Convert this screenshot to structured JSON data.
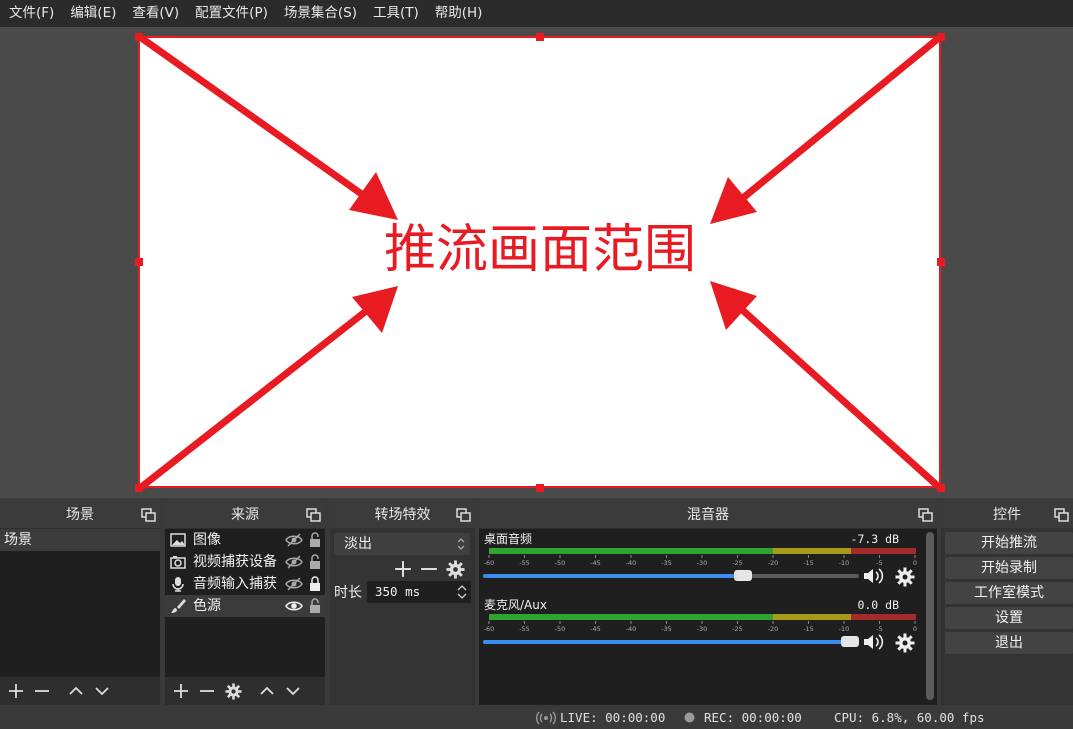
{
  "menu": [
    "文件(F)",
    "编辑(E)",
    "查看(V)",
    "配置文件(P)",
    "场景集合(S)",
    "工具(T)",
    "帮助(H)"
  ],
  "preview": {
    "annotation_text": "推流画面范围",
    "annotation_color": "#e81b23"
  },
  "scenes": {
    "title": "场景",
    "items": [
      "场景"
    ]
  },
  "sources": {
    "title": "来源",
    "items": [
      {
        "label": "图像",
        "icon": "image-icon"
      },
      {
        "label": "视频捕获设备",
        "icon": "camera-icon"
      },
      {
        "label": "音频输入捕获",
        "icon": "microphone-icon"
      },
      {
        "label": "色源",
        "icon": "brush-icon"
      }
    ]
  },
  "transitions": {
    "title": "转场特效",
    "selected": "淡出",
    "duration_label": "时长",
    "duration_value": "350 ms"
  },
  "mixer": {
    "title": "混音器",
    "channels": [
      {
        "name": "桌面音频",
        "db": "-7.3 dB",
        "volume": 0.7
      },
      {
        "name": "麦克风/Aux",
        "db": "0.0 dB",
        "volume": 1.0
      }
    ],
    "ticks": [
      "-60",
      "-55",
      "-50",
      "-45",
      "-40",
      "-35",
      "-30",
      "-25",
      "-20",
      "-15",
      "-10",
      "-5",
      "0"
    ]
  },
  "controls": {
    "title": "控件",
    "buttons": [
      "开始推流",
      "开始录制",
      "工作室模式",
      "设置",
      "退出"
    ]
  },
  "status": {
    "live": "LIVE: 00:00:00",
    "rec": "REC: 00:00:00",
    "cpu": "CPU: 6.8%, 60.00 fps"
  },
  "colors": {
    "accent_blue": "#3a8ef0",
    "meter_green": "#2fa52f",
    "meter_yellow": "#a89a1a",
    "meter_red": "#a52a2a"
  }
}
